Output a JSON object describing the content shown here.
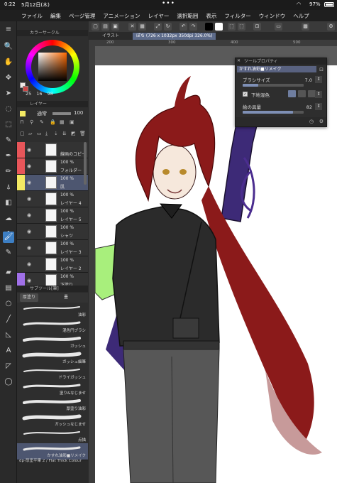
{
  "status_bar": {
    "time": "0:22",
    "date": "5月12日(木)",
    "battery": "97%"
  },
  "menu": {
    "items": [
      "ファイル",
      "編集",
      "ページ管理",
      "アニメーション",
      "レイヤー",
      "選択範囲",
      "表示",
      "フィルター",
      "ウィンドウ",
      "ヘルプ"
    ]
  },
  "panels": {
    "color_title": "カラーサークル",
    "color_values": {
      "h": "25",
      "s": "16",
      "v": "98"
    },
    "layer_title": "レイヤー",
    "blend_mode": "通常",
    "opacity": "100",
    "subtool_title": "サブツール[筆]",
    "subtool_tabs": [
      "厚塗り",
      "墨"
    ]
  },
  "layers": [
    {
      "pct": "",
      "name": "線画のコピー",
      "color": "#e8565a",
      "selected": false
    },
    {
      "pct": "100 %",
      "name": "フォルダー",
      "color": "#e8565a",
      "selected": false
    },
    {
      "pct": "100 %",
      "name": "肌",
      "color": "#f4ea64",
      "selected": true
    },
    {
      "pct": "100 %",
      "name": "レイヤー 4",
      "color": "",
      "selected": false
    },
    {
      "pct": "100 %",
      "name": "レイヤー 5",
      "color": "",
      "selected": false
    },
    {
      "pct": "100 %",
      "name": "シャツ",
      "color": "",
      "selected": false
    },
    {
      "pct": "100 %",
      "name": "レイヤー 3",
      "color": "",
      "selected": false
    },
    {
      "pct": "100 %",
      "name": "レイヤー 2",
      "color": "",
      "selected": false
    },
    {
      "pct": "100 %",
      "name": "下塗り",
      "color": "#a070e8",
      "selected": false
    }
  ],
  "brushes": [
    {
      "name": "油彩",
      "selected": false
    },
    {
      "name": "混色円ブラシ",
      "selected": false
    },
    {
      "name": "ガッシュ",
      "selected": false
    },
    {
      "name": "ガッシュ細筆",
      "selected": false
    },
    {
      "name": "ドライガッシュ",
      "selected": false
    },
    {
      "name": "塗り&なじませ",
      "selected": false
    },
    {
      "name": "厚塗り油彩",
      "selected": false
    },
    {
      "name": "ガッシュなじませ",
      "selected": false
    },
    {
      "name": "点描",
      "selected": false
    },
    {
      "name": "かすれ油彩■リメイク",
      "selected": true
    }
  ],
  "subtool_footer": "dp-厚塗平筆 2 / Flat Thick Colour",
  "canvas": {
    "tabs": [
      {
        "label": "イラスト",
        "active": false
      },
      {
        "label": "ぽち (726 x 1032px 350dpi 326.0%)",
        "active": true
      }
    ],
    "ruler_marks": [
      "200",
      "300",
      "400",
      "500"
    ]
  },
  "tool_property": {
    "title": "ツールプロパティ",
    "brush_name": "かすれ油彩■リメイク",
    "brush_size_label": "ブラシサイズ",
    "brush_size_value": "7.0",
    "brush_size_fraction": 0.25,
    "underlay_label": "下地混色",
    "paint_amount_label": "絵の具量",
    "paint_amount_value": "82",
    "paint_amount_fraction": 0.82
  },
  "colors": {
    "accent": "#3d7fc4",
    "selection": "#4d5670",
    "fg_color": "#efe8e6",
    "hair": "#8b1a1a",
    "shirt": "#2a2a2a"
  }
}
